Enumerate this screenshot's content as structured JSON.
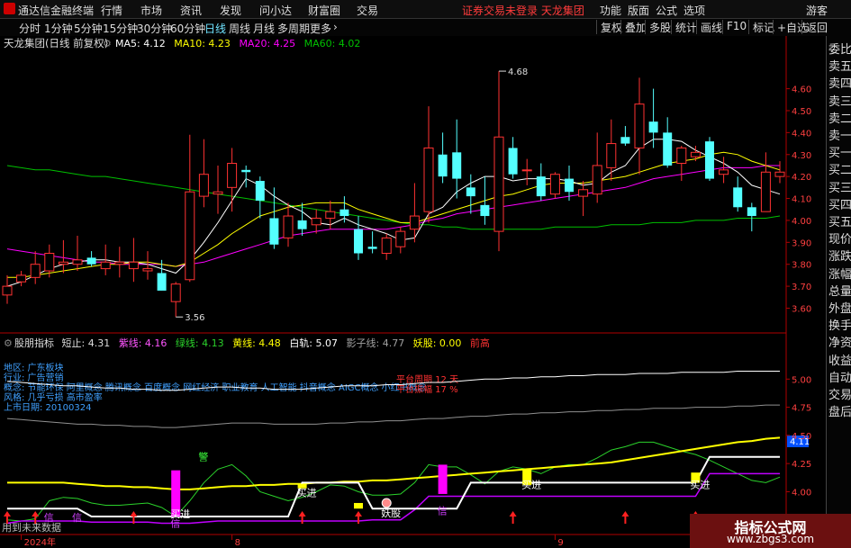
{
  "menubar": {
    "app_name": "通达信金融终端",
    "items": [
      "行情",
      "市场",
      "资讯",
      "发现",
      "问小达",
      "财富圈",
      "交易"
    ],
    "warning": "证券交易未登录  天龙集团",
    "right_items": [
      "功能",
      "版面",
      "公式",
      "选项"
    ],
    "guest": "游客"
  },
  "toolbar": {
    "timeframes": [
      "分时",
      "1分钟",
      "5分钟",
      "15分钟",
      "30分钟",
      "60分钟",
      "日线",
      "周线",
      "月线",
      "多周期",
      "更多"
    ],
    "active": "日线",
    "right_buttons": [
      "复权",
      "叠加",
      "多股",
      "统计",
      "画线",
      "F10",
      "标记",
      "+自选",
      "返回"
    ]
  },
  "sidebar": {
    "items": [
      "委比",
      "卖五",
      "卖四",
      "卖三",
      "卖二",
      "卖一",
      "买一",
      "买二",
      "买三",
      "买四",
      "买五",
      "现价",
      "涨跌",
      "涨幅",
      "总量",
      "外盘",
      "换手",
      "净资",
      "收益",
      "自动",
      "交易",
      "盘后"
    ]
  },
  "colors": {
    "up": "#ff3232",
    "down": "#54ffff",
    "ma5": "#ffffff",
    "ma10": "#ffff00",
    "ma20": "#ff00ff",
    "ma60": "#00c000"
  },
  "chart_data": [
    {
      "type": "candlestick",
      "header": {
        "name": "天龙集团(日线 前复权)",
        "ma_labels": [
          {
            "text": "MA5: 4.12",
            "color": "#ffffff"
          },
          {
            "text": "MA10: 4.23",
            "color": "#ffff00"
          },
          {
            "text": "MA20: 4.25",
            "color": "#ff00ff"
          },
          {
            "text": "MA60: 4.02",
            "color": "#00c000"
          }
        ]
      },
      "ylim": [
        3.52,
        4.75
      ],
      "yticks": [
        "3.60",
        "3.70",
        "3.80",
        "3.90",
        "4.00",
        "4.10",
        "4.20",
        "4.30",
        "4.40",
        "4.50",
        "4.60"
      ],
      "candles": [
        {
          "o": 3.66,
          "h": 3.75,
          "l": 3.62,
          "c": 3.7
        },
        {
          "o": 3.72,
          "h": 3.77,
          "l": 3.7,
          "c": 3.75
        },
        {
          "o": 3.74,
          "h": 3.86,
          "l": 3.71,
          "c": 3.8
        },
        {
          "o": 3.77,
          "h": 3.89,
          "l": 3.74,
          "c": 3.85
        },
        {
          "o": 3.8,
          "h": 3.91,
          "l": 3.76,
          "c": 3.81
        },
        {
          "o": 3.8,
          "h": 3.93,
          "l": 3.77,
          "c": 3.82
        },
        {
          "o": 3.83,
          "h": 3.86,
          "l": 3.79,
          "c": 3.8
        },
        {
          "o": 3.78,
          "h": 3.89,
          "l": 3.75,
          "c": 3.81
        },
        {
          "o": 3.8,
          "h": 3.88,
          "l": 3.74,
          "c": 3.81
        },
        {
          "o": 3.78,
          "h": 3.92,
          "l": 3.72,
          "c": 3.81
        },
        {
          "o": 3.77,
          "h": 3.86,
          "l": 3.73,
          "c": 3.78
        },
        {
          "o": 3.76,
          "h": 3.82,
          "l": 3.68,
          "c": 3.68
        },
        {
          "o": 3.63,
          "h": 3.72,
          "l": 3.56,
          "c": 3.71
        },
        {
          "o": 3.73,
          "h": 4.39,
          "l": 3.72,
          "c": 4.13
        },
        {
          "o": 4.11,
          "h": 4.37,
          "l": 4.06,
          "c": 4.21
        },
        {
          "o": 4.12,
          "h": 4.25,
          "l": 4.03,
          "c": 4.13
        },
        {
          "o": 4.15,
          "h": 4.33,
          "l": 4.04,
          "c": 4.26
        },
        {
          "o": 4.23,
          "h": 4.25,
          "l": 4.15,
          "c": 4.22
        },
        {
          "o": 4.18,
          "h": 4.2,
          "l": 4.01,
          "c": 4.09
        },
        {
          "o": 4.01,
          "h": 4.15,
          "l": 3.87,
          "c": 3.89
        },
        {
          "o": 3.92,
          "h": 4.08,
          "l": 3.88,
          "c": 4.02
        },
        {
          "o": 4.0,
          "h": 4.08,
          "l": 3.93,
          "c": 3.96
        },
        {
          "o": 3.98,
          "h": 4.05,
          "l": 3.94,
          "c": 4.01
        },
        {
          "o": 4.01,
          "h": 4.09,
          "l": 3.96,
          "c": 4.04
        },
        {
          "o": 4.05,
          "h": 4.11,
          "l": 3.99,
          "c": 4.02
        },
        {
          "o": 3.96,
          "h": 4.02,
          "l": 3.82,
          "c": 3.85
        },
        {
          "o": 3.88,
          "h": 3.95,
          "l": 3.85,
          "c": 3.87
        },
        {
          "o": 3.85,
          "h": 3.94,
          "l": 3.82,
          "c": 3.92
        },
        {
          "o": 3.88,
          "h": 3.97,
          "l": 3.85,
          "c": 3.95
        },
        {
          "o": 3.96,
          "h": 4.17,
          "l": 3.9,
          "c": 4.02
        },
        {
          "o": 4.04,
          "h": 4.52,
          "l": 3.99,
          "c": 4.33
        },
        {
          "o": 4.3,
          "h": 4.4,
          "l": 4.17,
          "c": 4.2
        },
        {
          "o": 4.31,
          "h": 4.46,
          "l": 4.1,
          "c": 4.19
        },
        {
          "o": 4.15,
          "h": 4.21,
          "l": 4.03,
          "c": 4.11
        },
        {
          "o": 4.07,
          "h": 4.2,
          "l": 3.98,
          "c": 4.02
        },
        {
          "o": 3.95,
          "h": 4.68,
          "l": 3.86,
          "c": 4.38
        },
        {
          "o": 4.33,
          "h": 4.38,
          "l": 4.19,
          "c": 4.21
        },
        {
          "o": 4.23,
          "h": 4.28,
          "l": 4.16,
          "c": 4.23
        },
        {
          "o": 4.2,
          "h": 4.26,
          "l": 4.09,
          "c": 4.11
        },
        {
          "o": 4.12,
          "h": 4.22,
          "l": 4.1,
          "c": 4.21
        },
        {
          "o": 4.19,
          "h": 4.25,
          "l": 4.09,
          "c": 4.13
        },
        {
          "o": 4.11,
          "h": 4.18,
          "l": 4.02,
          "c": 4.14
        },
        {
          "o": 4.12,
          "h": 4.4,
          "l": 4.08,
          "c": 4.25
        },
        {
          "o": 4.24,
          "h": 4.46,
          "l": 4.18,
          "c": 4.35
        },
        {
          "o": 4.38,
          "h": 4.43,
          "l": 4.34,
          "c": 4.35
        },
        {
          "o": 4.33,
          "h": 4.65,
          "l": 4.21,
          "c": 4.53
        },
        {
          "o": 4.45,
          "h": 4.6,
          "l": 4.33,
          "c": 4.4
        },
        {
          "o": 4.4,
          "h": 4.47,
          "l": 4.24,
          "c": 4.25
        },
        {
          "o": 4.26,
          "h": 4.34,
          "l": 4.18,
          "c": 4.33
        },
        {
          "o": 4.29,
          "h": 4.34,
          "l": 4.27,
          "c": 4.31
        },
        {
          "o": 4.36,
          "h": 4.38,
          "l": 4.18,
          "c": 4.19
        },
        {
          "o": 4.21,
          "h": 4.29,
          "l": 4.17,
          "c": 4.23
        },
        {
          "o": 4.15,
          "h": 4.2,
          "l": 4.04,
          "c": 4.06
        },
        {
          "o": 4.06,
          "h": 4.08,
          "l": 3.95,
          "c": 4.02
        },
        {
          "o": 4.04,
          "h": 4.31,
          "l": 4.04,
          "c": 4.22
        },
        {
          "o": 4.2,
          "h": 4.27,
          "l": 4.17,
          "c": 4.22
        }
      ],
      "ma5": [
        3.7,
        3.72,
        3.75,
        3.78,
        3.8,
        3.81,
        3.82,
        3.82,
        3.81,
        3.81,
        3.8,
        3.78,
        3.76,
        3.82,
        3.9,
        3.99,
        4.09,
        4.19,
        4.16,
        4.11,
        4.07,
        4.04,
        3.99,
        3.98,
        4.01,
        3.98,
        3.96,
        3.94,
        3.91,
        3.92,
        4.03,
        4.06,
        4.13,
        4.17,
        4.2,
        4.2,
        4.18,
        4.19,
        4.19,
        4.19,
        4.18,
        4.16,
        4.17,
        4.22,
        4.25,
        4.33,
        4.37,
        4.37,
        4.36,
        4.32,
        4.29,
        4.26,
        4.22,
        4.16,
        4.14,
        4.12
      ],
      "ma10": [
        3.74,
        3.74,
        3.75,
        3.76,
        3.77,
        3.78,
        3.79,
        3.8,
        3.8,
        3.81,
        3.81,
        3.8,
        3.79,
        3.81,
        3.85,
        3.89,
        3.94,
        3.98,
        4.02,
        4.04,
        4.06,
        4.07,
        4.08,
        4.08,
        4.08,
        4.05,
        4.03,
        4.01,
        3.99,
        3.99,
        4.01,
        4.03,
        4.05,
        4.07,
        4.09,
        4.11,
        4.12,
        4.14,
        4.16,
        4.17,
        4.17,
        4.17,
        4.18,
        4.19,
        4.2,
        4.22,
        4.24,
        4.26,
        4.27,
        4.28,
        4.3,
        4.31,
        4.3,
        4.27,
        4.25,
        4.23
      ],
      "ma20": [
        3.87,
        3.86,
        3.85,
        3.84,
        3.83,
        3.82,
        3.81,
        3.81,
        3.8,
        3.8,
        3.8,
        3.8,
        3.79,
        3.8,
        3.81,
        3.83,
        3.85,
        3.87,
        3.89,
        3.91,
        3.93,
        3.94,
        3.95,
        3.96,
        3.96,
        3.96,
        3.96,
        3.96,
        3.97,
        3.98,
        4.0,
        4.01,
        4.03,
        4.04,
        4.05,
        4.06,
        4.07,
        4.08,
        4.09,
        4.1,
        4.11,
        4.12,
        4.13,
        4.14,
        4.15,
        4.17,
        4.19,
        4.2,
        4.21,
        4.22,
        4.23,
        4.24,
        4.24,
        4.24,
        4.25,
        4.25
      ],
      "ma60": [
        4.25,
        4.24,
        4.23,
        4.23,
        4.22,
        4.21,
        4.2,
        4.2,
        4.19,
        4.18,
        4.17,
        4.16,
        4.15,
        4.14,
        4.13,
        4.12,
        4.11,
        4.1,
        4.09,
        4.08,
        4.07,
        4.06,
        4.05,
        4.04,
        4.03,
        4.02,
        4.01,
        4.0,
        3.99,
        3.98,
        3.98,
        3.97,
        3.97,
        3.96,
        3.96,
        3.96,
        3.96,
        3.96,
        3.96,
        3.97,
        3.97,
        3.97,
        3.97,
        3.98,
        3.98,
        3.98,
        3.99,
        3.99,
        3.99,
        4.0,
        4.0,
        4.0,
        4.01,
        4.01,
        4.01,
        4.02
      ],
      "annotations": [
        {
          "text": "4.68",
          "x": 35,
          "y": 4.68
        },
        {
          "text": "3.56",
          "x": 12,
          "y": 3.56
        }
      ]
    },
    {
      "type": "indicator",
      "header": {
        "name": "股朋指标",
        "values": [
          {
            "text": "短止: 4.31",
            "color": "#dddddd"
          },
          {
            "text": "紫线: 4.16",
            "color": "#ff55ff"
          },
          {
            "text": "绿线: 4.13",
            "color": "#2bd22b"
          },
          {
            "text": "黄线: 4.48",
            "color": "#ffff00"
          },
          {
            "text": "白轨: 5.07",
            "color": "#ffffff"
          },
          {
            "text": "影子线: 4.77",
            "color": "#a0a0a0"
          },
          {
            "text": "妖股: 0.00",
            "color": "#ffff00"
          },
          {
            "text": "前高",
            "color": "#ff3232"
          }
        ]
      },
      "info_lines": [
        "地区:    广东板块",
        "行业:    广告营销",
        "概念:    节能环保 阿里概念 腾讯概念 百度概念 网红经济 职业教育 人工智能 抖音概念 AIGC概念 小红书概念",
        "风格:    几乎亏损 高市盈率",
        "上市日期: 20100324"
      ],
      "red_notes": [
        "平台周期 12 天",
        "平台振幅 17 %"
      ],
      "ylim": [
        3.7,
        5.25
      ],
      "yticks": [
        "3.75",
        "4.00",
        "4.25",
        "4.50",
        "4.75",
        "5.00"
      ],
      "current_value": "4.11",
      "white_upper": [
        4.98,
        4.97,
        4.96,
        4.95,
        4.94,
        4.94,
        4.93,
        4.92,
        4.92,
        4.91,
        4.91,
        4.9,
        4.9,
        4.91,
        4.92,
        4.93,
        4.93,
        4.92,
        4.92,
        4.91,
        4.91,
        4.91,
        4.92,
        4.93,
        4.94,
        4.94,
        4.94,
        4.95,
        4.95,
        4.96,
        4.97,
        4.97,
        4.98,
        4.99,
        5.0,
        5.0,
        5.01,
        5.01,
        5.02,
        5.02,
        5.03,
        5.03,
        5.04,
        5.04,
        5.04,
        5.05,
        5.05,
        5.05,
        5.06,
        5.06,
        5.06,
        5.06,
        5.07,
        5.07,
        5.07,
        5.07
      ],
      "gray_shadow": [
        4.65,
        4.64,
        4.63,
        4.62,
        4.61,
        4.6,
        4.6,
        4.59,
        4.59,
        4.58,
        4.58,
        4.57,
        4.57,
        4.58,
        4.59,
        4.6,
        4.61,
        4.61,
        4.61,
        4.6,
        4.6,
        4.6,
        4.6,
        4.61,
        4.61,
        4.62,
        4.62,
        4.63,
        4.63,
        4.64,
        4.65,
        4.65,
        4.66,
        4.67,
        4.67,
        4.68,
        4.69,
        4.69,
        4.7,
        4.7,
        4.71,
        4.71,
        4.72,
        4.72,
        4.73,
        4.73,
        4.74,
        4.74,
        4.74,
        4.75,
        4.75,
        4.75,
        4.76,
        4.76,
        4.77,
        4.77
      ],
      "yellow_line": [
        4.08,
        4.08,
        4.08,
        4.08,
        4.08,
        4.07,
        4.06,
        4.05,
        4.05,
        4.04,
        4.04,
        4.03,
        4.02,
        4.02,
        4.03,
        4.04,
        4.05,
        4.05,
        4.06,
        4.06,
        4.07,
        4.07,
        4.08,
        4.08,
        4.09,
        4.09,
        4.1,
        4.1,
        4.11,
        4.12,
        4.13,
        4.14,
        4.15,
        4.16,
        4.17,
        4.18,
        4.19,
        4.2,
        4.21,
        4.22,
        4.23,
        4.24,
        4.25,
        4.26,
        4.28,
        4.3,
        4.32,
        4.34,
        4.36,
        4.38,
        4.4,
        4.42,
        4.44,
        4.45,
        4.47,
        4.48
      ],
      "white_step": [
        3.85,
        3.85,
        3.85,
        3.85,
        3.85,
        3.85,
        3.78,
        3.78,
        3.78,
        3.78,
        3.78,
        3.78,
        3.78,
        3.78,
        3.78,
        3.78,
        3.78,
        3.78,
        3.78,
        3.78,
        3.78,
        4.08,
        4.08,
        4.08,
        4.08,
        4.08,
        3.85,
        3.85,
        3.85,
        3.85,
        3.85,
        3.85,
        3.85,
        4.08,
        4.08,
        4.08,
        4.08,
        4.08,
        4.08,
        4.08,
        4.08,
        4.08,
        4.08,
        4.08,
        4.08,
        4.08,
        4.08,
        4.08,
        4.08,
        4.08,
        4.31,
        4.31,
        4.31,
        4.31,
        4.31,
        4.31
      ],
      "magenta_line": [
        3.72,
        3.74,
        3.74,
        3.74,
        3.74,
        3.74,
        3.73,
        3.73,
        3.73,
        3.73,
        3.73,
        3.72,
        3.72,
        3.72,
        3.73,
        3.74,
        3.74,
        3.74,
        3.74,
        3.74,
        3.74,
        3.74,
        3.74,
        3.74,
        3.74,
        3.74,
        3.75,
        3.75,
        3.75,
        3.84,
        3.96,
        3.96,
        3.96,
        3.96,
        3.96,
        3.96,
        3.96,
        3.96,
        3.96,
        3.96,
        3.96,
        3.96,
        3.96,
        3.96,
        3.96,
        3.96,
        3.96,
        3.96,
        3.96,
        3.96,
        4.16,
        4.16,
        4.16,
        4.16,
        4.16,
        4.16
      ],
      "green_line": [
        3.75,
        3.74,
        3.76,
        3.92,
        3.95,
        3.94,
        3.9,
        3.88,
        3.88,
        3.89,
        3.9,
        3.86,
        3.78,
        3.92,
        4.08,
        4.2,
        4.24,
        4.14,
        4.0,
        3.96,
        3.92,
        3.95,
        4.0,
        4.06,
        4.05,
        4.0,
        3.97,
        3.97,
        3.98,
        4.08,
        4.24,
        4.22,
        4.22,
        4.15,
        4.07,
        4.18,
        4.22,
        4.2,
        4.16,
        4.22,
        4.24,
        4.24,
        4.3,
        4.37,
        4.4,
        4.44,
        4.44,
        4.4,
        4.36,
        4.33,
        4.28,
        4.22,
        4.16,
        4.1,
        4.08,
        4.13
      ],
      "magenta_bars": [
        {
          "i": 12,
          "top": 4.19,
          "bottom": 3.78
        },
        {
          "i": 31,
          "top": 4.24,
          "bottom": 3.98
        }
      ],
      "yellow_bars": [
        {
          "i": 21,
          "top": 4.07,
          "bottom": 4.03
        },
        {
          "i": 25,
          "top": 3.9,
          "bottom": 3.85
        },
        {
          "i": 37,
          "top": 4.2,
          "bottom": 4.06
        },
        {
          "i": 49,
          "top": 4.17,
          "bottom": 4.08
        }
      ],
      "up_arrows": [
        0,
        2,
        9,
        21,
        25,
        36,
        44,
        49
      ],
      "labels": [
        {
          "text": "信",
          "i": 3,
          "y": 3.74,
          "color": "#d040ff"
        },
        {
          "text": "信",
          "i": 5,
          "y": 3.74,
          "color": "#d040ff"
        },
        {
          "text": "买进",
          "i": 12,
          "y": 3.77,
          "color": "#ffffff"
        },
        {
          "text": "信",
          "i": 12,
          "y": 3.69,
          "color": "#d040ff"
        },
        {
          "text": "买进",
          "i": 21,
          "y": 3.96,
          "color": "#ffffff"
        },
        {
          "text": "妖股",
          "i": 27,
          "y": 3.78,
          "color": "#ffffff"
        },
        {
          "text": "信",
          "i": 31,
          "y": 3.8,
          "color": "#d040ff"
        },
        {
          "text": "买进",
          "i": 37,
          "y": 4.03,
          "color": "#ffffff"
        },
        {
          "text": "买进",
          "i": 49,
          "y": 4.03,
          "color": "#ffffff"
        },
        {
          "text": "警",
          "i": 14,
          "y": 4.28,
          "color": "#3cff3c"
        }
      ],
      "circle_marker": {
        "i": 27,
        "y": 3.9
      }
    }
  ],
  "date_axis": {
    "labels": [
      "2024年",
      "8",
      "9"
    ],
    "positions_idx": [
      1,
      16,
      39
    ]
  },
  "bottom_note": "用到未来数据",
  "watermark": {
    "line1": "指标公式网",
    "line2": "www.zbgs3.com"
  }
}
